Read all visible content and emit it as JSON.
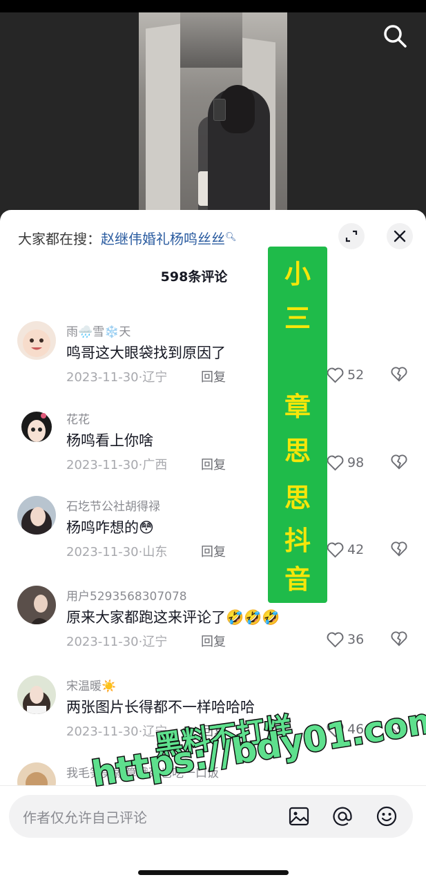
{
  "hot_search": {
    "prefix": "大家都在搜：",
    "keyword": "赵继伟婚礼杨鸣丝丝"
  },
  "comment_count_title": "598条评论",
  "comments": [
    {
      "user": "雨🌧️雪❄️天",
      "text": "鸣哥这大眼袋找到原因了",
      "date": "2023-11-30",
      "location": "辽宁",
      "likes": "52"
    },
    {
      "user": "花花",
      "text": "杨鸣看上你啥",
      "date": "2023-11-30",
      "location": "广西",
      "likes": "98"
    },
    {
      "user": "石圪节公社胡得禄",
      "text": "杨鸣咋想的😳",
      "date": "2023-11-30",
      "location": "山东",
      "likes": "42"
    },
    {
      "user": "用户5293568307078",
      "text": "原来大家都跑这来评论了🤣🤣🤣",
      "date": "2023-11-30",
      "location": "辽宁",
      "likes": "36"
    },
    {
      "user": "宋温暖☀️",
      "text": "两张图片长得都不一样哈哈哈",
      "date": "2023-11-30",
      "location": "辽宁",
      "likes": "46"
    },
    {
      "user": "我毛笋笋就算饿死也吃一口饭"
    }
  ],
  "reply_label": "回复",
  "meta_sep": "·",
  "overlay": {
    "chars": [
      "小",
      "三",
      "章",
      "思",
      "思",
      "抖",
      "音"
    ],
    "bg_color": "#1fbb4a",
    "text_color": "#f5e60a"
  },
  "watermark": {
    "line1": "黑料不打烊",
    "line2": "https://bdy01.com"
  },
  "input": {
    "placeholder": "作者仅允许自己评论"
  },
  "icons": [
    "search-icon",
    "expand-icon",
    "close-icon",
    "heart-icon",
    "dislike-icon",
    "image-icon",
    "at-icon",
    "emoji-icon"
  ]
}
